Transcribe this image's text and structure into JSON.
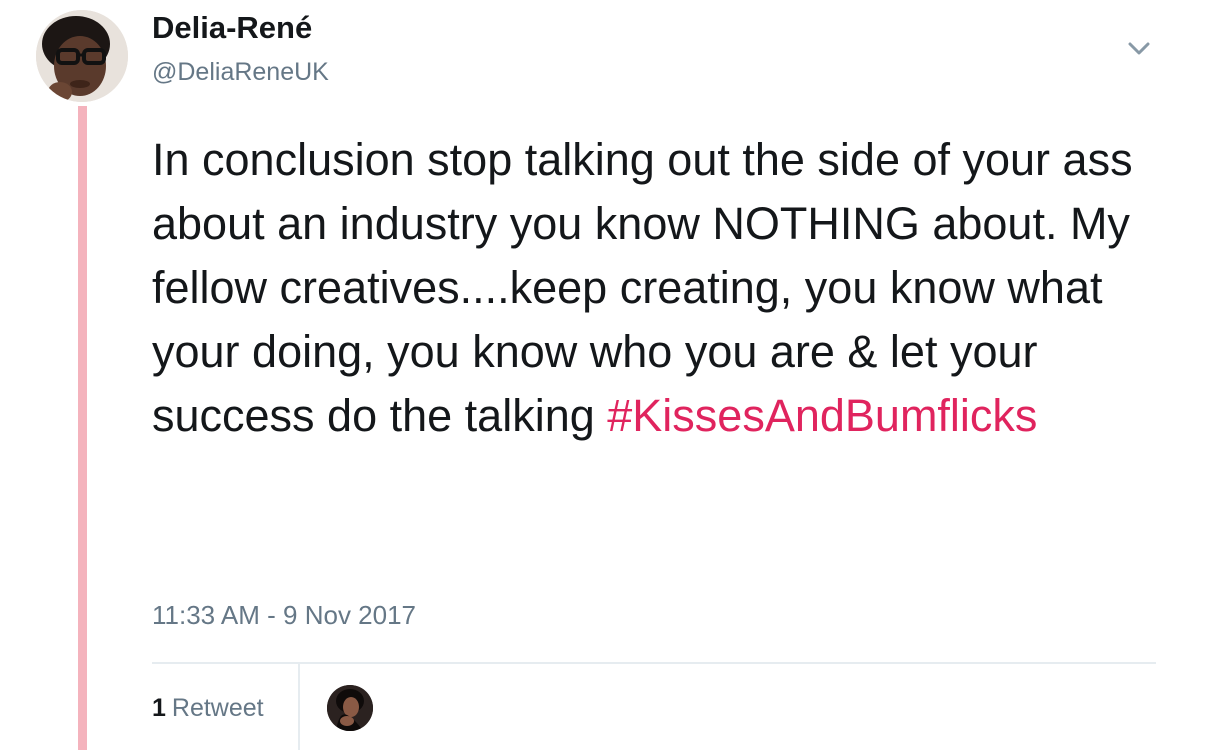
{
  "author": {
    "display_name": "Delia-René",
    "handle": "@DeliaReneUK"
  },
  "tweet": {
    "text": "In conclusion stop talking out the side of your ass about an industry you know NOTHING about. My fellow creatives....keep creating, you know what your doing, you know who you are & let your success do the talking",
    "hashtag": "#KissesAndBumflicks",
    "timestamp": "11:33 AM - 9 Nov 2017"
  },
  "stats": {
    "retweet_count": "1",
    "retweet_label": "Retweet"
  },
  "icons": {
    "menu": "chevron-down-icon"
  },
  "colors": {
    "hashtag": "#e0245e",
    "thread_line": "#f4b3bd",
    "secondary_text": "#657786",
    "primary_text": "#14171a"
  }
}
